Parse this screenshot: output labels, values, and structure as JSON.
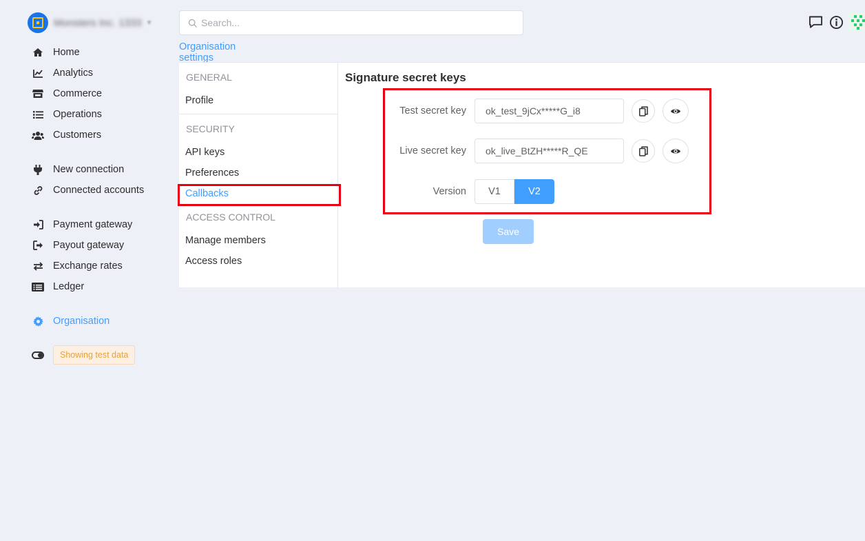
{
  "org": {
    "name": "Monsters Inc. 1333"
  },
  "sidebar": {
    "groups": [
      [
        {
          "label": "Home",
          "icon": "home-icon"
        },
        {
          "label": "Analytics",
          "icon": "chart-line-icon"
        },
        {
          "label": "Commerce",
          "icon": "store-icon"
        },
        {
          "label": "Operations",
          "icon": "list-icon"
        },
        {
          "label": "Customers",
          "icon": "users-icon"
        }
      ],
      [
        {
          "label": "New connection",
          "icon": "plug-icon"
        },
        {
          "label": "Connected accounts",
          "icon": "link-icon"
        }
      ],
      [
        {
          "label": "Payment gateway",
          "icon": "sign-in-icon"
        },
        {
          "label": "Payout gateway",
          "icon": "sign-out-icon"
        },
        {
          "label": "Exchange rates",
          "icon": "exchange-icon"
        },
        {
          "label": "Ledger",
          "icon": "ledger-icon"
        }
      ],
      [
        {
          "label": "Organisation",
          "icon": "gear-icon"
        }
      ]
    ],
    "test_data_label": "Showing test data"
  },
  "search": {
    "placeholder": "Search..."
  },
  "tabs": {
    "active": "Organisation settings"
  },
  "subnav": {
    "general": {
      "heading": "GENERAL",
      "items": [
        "Profile"
      ]
    },
    "security": {
      "heading": "SECURITY",
      "items": [
        "API keys",
        "Preferences",
        "Callbacks"
      ]
    },
    "access": {
      "heading": "ACCESS CONTROL",
      "items": [
        "Manage members",
        "Access roles"
      ]
    }
  },
  "content": {
    "title": "Signature secret keys",
    "test_key": {
      "label": "Test secret key",
      "value": "ok_test_9jCx*****G_i8"
    },
    "live_key": {
      "label": "Live secret key",
      "value": "ok_live_BtZH*****R_QE"
    },
    "version": {
      "label": "Version",
      "options": [
        "V1",
        "V2"
      ],
      "selected": "V2"
    },
    "save_label": "Save"
  },
  "colors": {
    "accent": "#409eff",
    "highlight": "#e60012",
    "badge_text": "#e6a23c"
  }
}
